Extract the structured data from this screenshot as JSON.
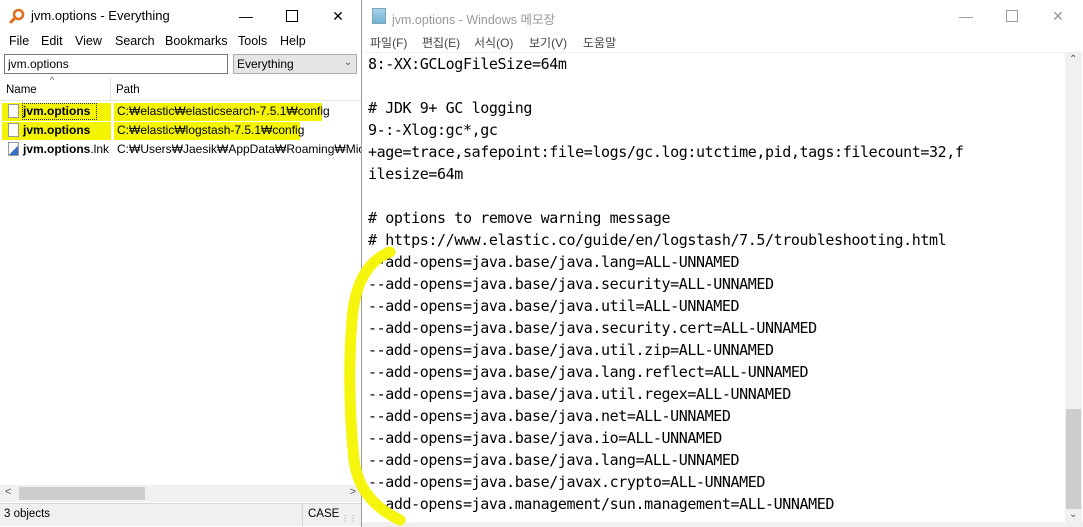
{
  "everything": {
    "title": "jvm.options - Everything",
    "menu": [
      "File",
      "Edit",
      "View",
      "Search",
      "Bookmarks",
      "Tools",
      "Help"
    ],
    "search": {
      "value": "jvm.options",
      "placeholder": ""
    },
    "filter": {
      "selected": "Everything"
    },
    "columns": {
      "name": "Name",
      "path": "Path",
      "sort": "ascending"
    },
    "rows": [
      {
        "name": "jvm.options",
        "ext": "",
        "path": "C:₩elastic₩elasticsearch-7.5.1₩config",
        "icon": "file-icon",
        "highlighted": true,
        "focused": true
      },
      {
        "name": "jvm.options",
        "ext": "",
        "path": "C:₩elastic₩logstash-7.5.1₩config",
        "icon": "file-icon",
        "highlighted": true,
        "focused": false
      },
      {
        "name": "jvm.options",
        "ext": ".lnk",
        "path": "C:₩Users₩Jaesik₩AppData₩Roaming₩Micros",
        "icon": "shortcut-icon",
        "highlighted": false,
        "focused": false
      }
    ],
    "status": {
      "count": "3 objects",
      "case": "CASE"
    },
    "highlight_color": "#f4f400"
  },
  "notepad": {
    "title": "jvm.options - Windows 메모장",
    "menu": [
      "파일(F)",
      "편집(E)",
      "서식(O)",
      "보기(V)",
      "도움말"
    ],
    "lines": [
      "8:-XX:GCLogFileSize=64m",
      "",
      "# JDK 9+ GC logging",
      "9-:-Xlog:gc*,gc",
      "+age=trace,safepoint:file=logs/gc.log:utctime,pid,tags:filecount=32,f",
      "ilesize=64m",
      "",
      "# options to remove warning message",
      "# https://www.elastic.co/guide/en/logstash/7.5/troubleshooting.html",
      "--add-opens=java.base/java.lang=ALL-UNNAMED",
      "--add-opens=java.base/java.security=ALL-UNNAMED",
      "--add-opens=java.base/java.util=ALL-UNNAMED",
      "--add-opens=java.base/java.security.cert=ALL-UNNAMED",
      "--add-opens=java.base/java.util.zip=ALL-UNNAMED",
      "--add-opens=java.base/java.lang.reflect=ALL-UNNAMED",
      "--add-opens=java.base/java.util.regex=ALL-UNNAMED",
      "--add-opens=java.base/java.net=ALL-UNNAMED",
      "--add-opens=java.base/java.io=ALL-UNNAMED",
      "--add-opens=java.base/java.lang=ALL-UNNAMED",
      "--add-opens=java.base/javax.crypto=ALL-UNNAMED",
      "--add-opens=java.management/sun.management=ALL-UNNAMED"
    ]
  },
  "annotation": {
    "type": "yellow-bracket",
    "color": "#f4f400"
  },
  "window_controls": {
    "minimize": "—",
    "maximize": "☐",
    "close": "✕"
  }
}
